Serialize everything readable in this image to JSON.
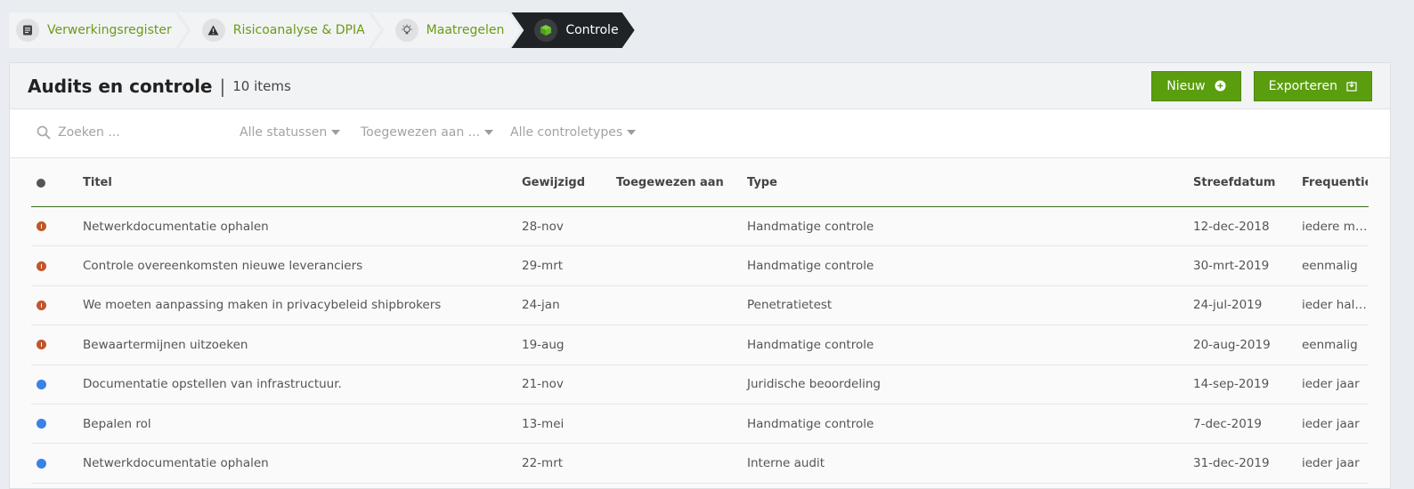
{
  "breadcrumb": [
    {
      "label": "Verwerkingsregister",
      "icon": "document-icon",
      "active": false
    },
    {
      "label": "Risicoanalyse & DPIA",
      "icon": "warning-icon",
      "active": false
    },
    {
      "label": "Maatregelen",
      "icon": "lightbulb-icon",
      "active": false
    },
    {
      "label": "Controle",
      "icon": "cube-icon",
      "active": true
    }
  ],
  "header": {
    "title": "Audits en controle",
    "separator": "|",
    "count": "10 items",
    "new_label": "Nieuw",
    "export_label": "Exporteren"
  },
  "filters": {
    "search_placeholder": "Zoeken ...",
    "status": "Alle statussen",
    "assigned": "Toegewezen aan ...",
    "types": "Alle controletypes"
  },
  "table": {
    "columns": {
      "title": "Titel",
      "modified": "Gewijzigd",
      "assigned": "Toegewezen aan",
      "type": "Type",
      "due": "Streefdatum",
      "frequency": "Frequentie"
    },
    "rows": [
      {
        "status": "warn",
        "title": "Netwerkdocumentatie ophalen",
        "modified": "28-nov",
        "assigned": "",
        "type": "Handmatige controle",
        "due": "12-dec-2018",
        "frequency": "iedere maand"
      },
      {
        "status": "warn",
        "title": "Controle overeenkomsten nieuwe leveranciers",
        "modified": "29-mrt",
        "assigned": "",
        "type": "Handmatige controle",
        "due": "30-mrt-2019",
        "frequency": "eenmalig"
      },
      {
        "status": "warn",
        "title": "We moeten aanpassing maken in privacybeleid shipbrokers",
        "modified": "24-jan",
        "assigned": "",
        "type": "Penetratietest",
        "due": "24-jul-2019",
        "frequency": "ieder halfjaar"
      },
      {
        "status": "warn",
        "title": "Bewaartermijnen uitzoeken",
        "modified": "19-aug",
        "assigned": "",
        "type": "Handmatige controle",
        "due": "20-aug-2019",
        "frequency": "eenmalig"
      },
      {
        "status": "info",
        "title": "Documentatie opstellen van infrastructuur.",
        "modified": "21-nov",
        "assigned": "",
        "type": "Juridische beoordeling",
        "due": "14-sep-2019",
        "frequency": "ieder jaar"
      },
      {
        "status": "info",
        "title": "Bepalen rol",
        "modified": "13-mei",
        "assigned": "",
        "type": "Handmatige controle",
        "due": "7-dec-2019",
        "frequency": "ieder jaar"
      },
      {
        "status": "info",
        "title": "Netwerkdocumentatie ophalen",
        "modified": "22-mrt",
        "assigned": "",
        "type": "Interne audit",
        "due": "31-dec-2019",
        "frequency": "ieder jaar"
      }
    ]
  },
  "colors": {
    "accent": "#5a9e0f",
    "warn": "#c0562c",
    "info": "#3a82e6",
    "active_crumb": "#202325"
  }
}
